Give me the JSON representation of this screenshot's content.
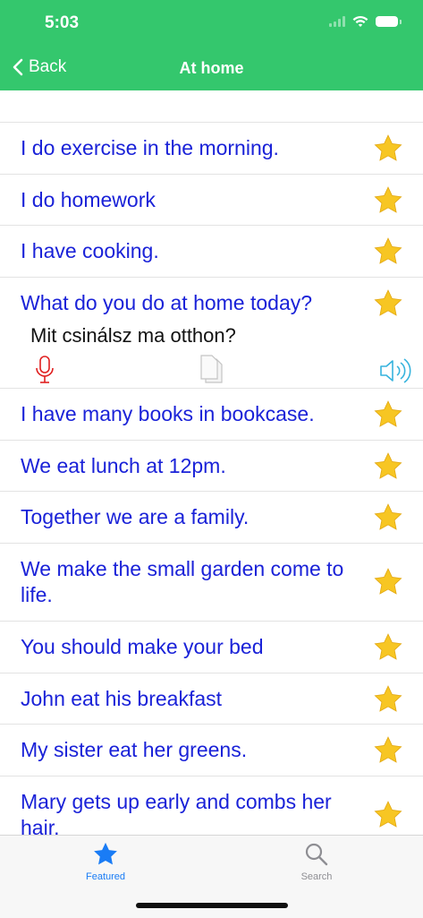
{
  "status": {
    "time": "5:03"
  },
  "nav": {
    "back_label": "Back",
    "title": "At home"
  },
  "phrases": [
    {
      "text": "I do exercise in the morning."
    },
    {
      "text": "I do homework"
    },
    {
      "text": "I have cooking."
    },
    {
      "text": "What do you do at home today?",
      "translation": "Mit csinálsz ma otthon?"
    },
    {
      "text": "I have many books in bookcase."
    },
    {
      "text": "We eat lunch at 12pm."
    },
    {
      "text": "Together we are a family."
    },
    {
      "text": "We make the small garden come to life."
    },
    {
      "text": "You should make your bed"
    },
    {
      "text": "John eat his breakfast"
    },
    {
      "text": "My sister eat her greens."
    },
    {
      "text": "Mary gets up early and combs her hair."
    }
  ],
  "tabs": {
    "featured": "Featured",
    "search": "Search"
  },
  "colors": {
    "header": "#34c76d",
    "phrase_text": "#1a22d8",
    "star": "#f7c623",
    "mic": "#e02020",
    "speaker": "#36b3dd",
    "tab_active": "#1a7cf5",
    "tab_inactive": "#8e8e93"
  }
}
